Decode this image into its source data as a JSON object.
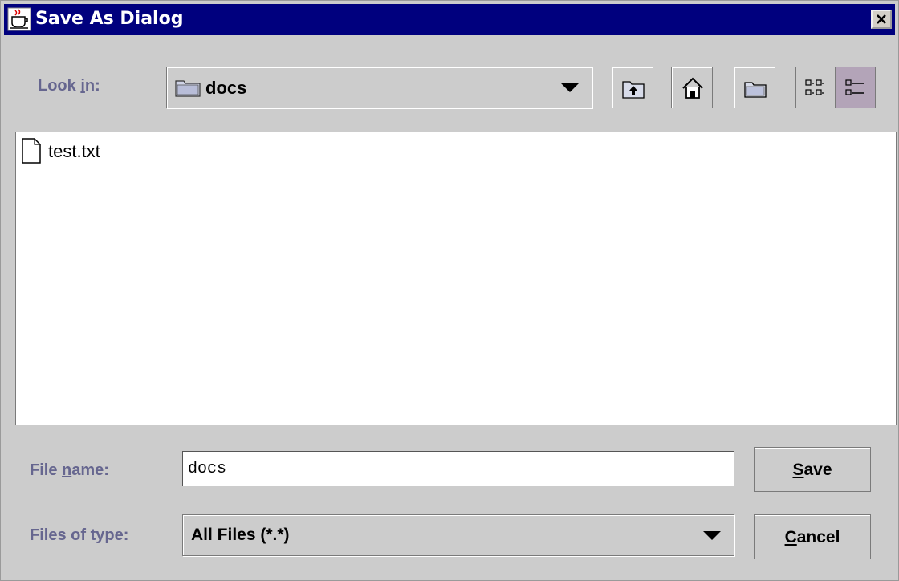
{
  "window": {
    "title": "Save As Dialog"
  },
  "look_in": {
    "label_pre": "Look ",
    "label_mn": "i",
    "label_post": "n:",
    "value": "docs"
  },
  "toolbar": {
    "icons": [
      "up-folder-icon",
      "home-icon",
      "new-folder-icon",
      "list-view-icon",
      "details-view-icon"
    ],
    "selected_view": "details"
  },
  "files": [
    {
      "name": "test.txt",
      "icon": "file-icon"
    }
  ],
  "file_name": {
    "label_pre": "File ",
    "label_mn": "n",
    "label_post": "ame:",
    "value": "docs"
  },
  "file_type": {
    "label": "Files of type:",
    "value": "All Files (*.*)"
  },
  "buttons": {
    "save_mn": "S",
    "save_rest": "ave",
    "cancel_mn": "C",
    "cancel_rest": "ancel"
  },
  "colors": {
    "titlebar": "#00007e",
    "label": "#66668f",
    "background": "#cccccc",
    "selected_view": "#b3a4b8"
  }
}
